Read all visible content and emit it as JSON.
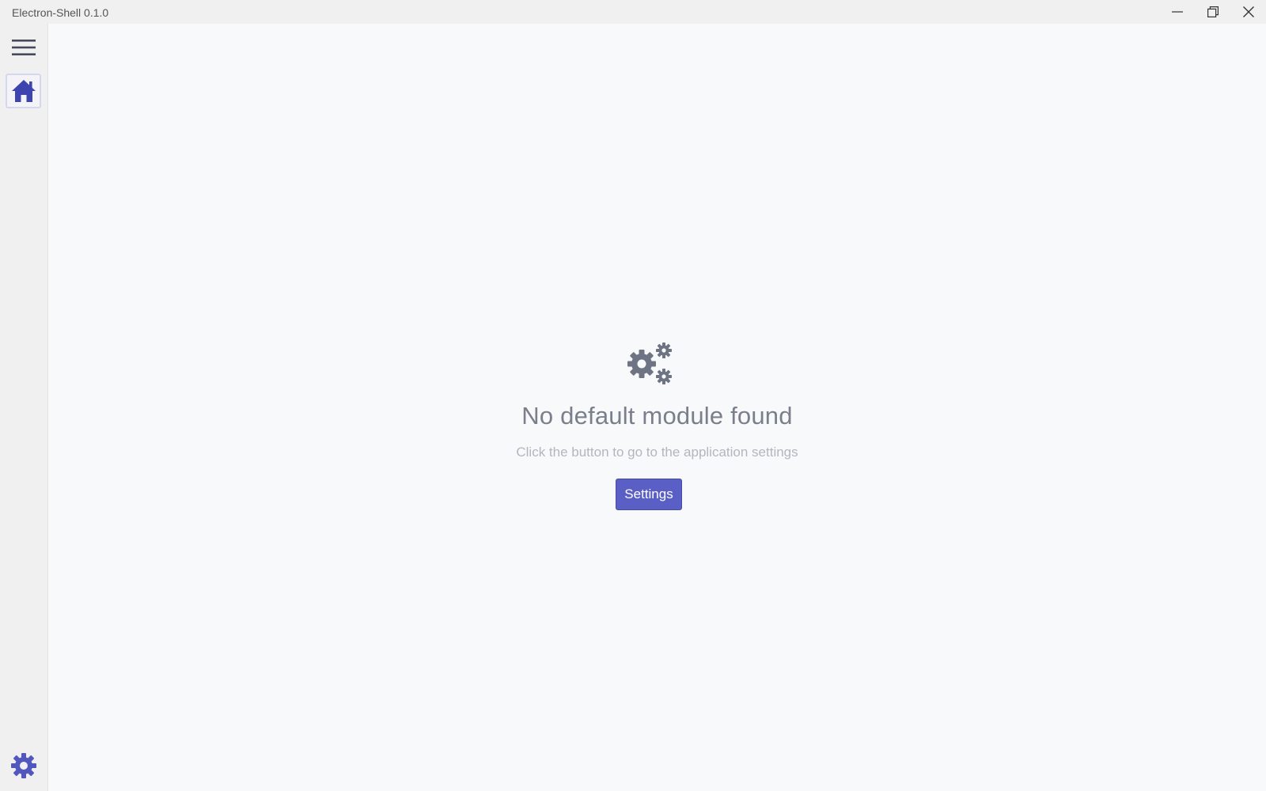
{
  "window": {
    "title": "Electron-Shell 0.1.0",
    "controls": [
      "minimize-icon",
      "restore-icon",
      "close-icon"
    ]
  },
  "sidebar": {
    "items": [
      {
        "icon": "hamburger-menu-icon"
      },
      {
        "icon": "home-icon",
        "active": true
      },
      {
        "icon": "gear-icon"
      }
    ],
    "accent_color": "#4a4fb5"
  },
  "main": {
    "icon": "gears-icon",
    "heading": "No default module found",
    "subtext": "Click the button to go to the application settings",
    "button_label": "Settings",
    "button_color": "#5a5fc6"
  }
}
